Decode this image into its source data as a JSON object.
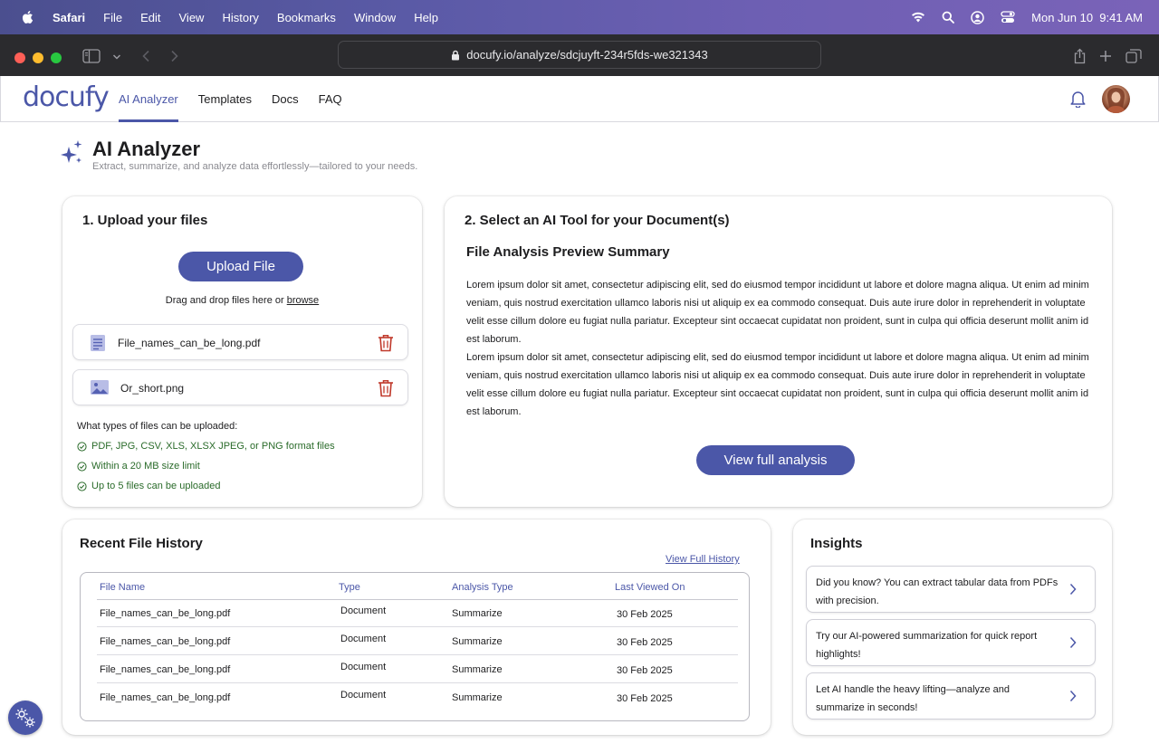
{
  "menubar": {
    "app": "Safari",
    "items": [
      "File",
      "Edit",
      "View",
      "History",
      "Bookmarks",
      "Window",
      "Help"
    ],
    "datetime": "Mon Jun 10  9:41 AM"
  },
  "browser": {
    "url": "docufy.io/analyze/sdcjuyft-234r5fds-we321343"
  },
  "header": {
    "logo": "docufy",
    "tabs": [
      {
        "label": "AI Analyzer",
        "active": true
      },
      {
        "label": "Templates"
      },
      {
        "label": "Docs"
      },
      {
        "label": "FAQ"
      }
    ]
  },
  "page": {
    "title": "AI Analyzer",
    "subtitle": "Extract, summarize, and analyze data effortlessly—tailored to your needs."
  },
  "upload": {
    "heading": "1. Upload your files",
    "button": "Upload File",
    "drag_text": "Drag and drop files here or ",
    "browse": "browse",
    "files": [
      {
        "name": "File_names_can_be_long.pdf",
        "icon": "document-icon"
      },
      {
        "name": "Or_short.png",
        "icon": "image-icon"
      }
    ],
    "types_heading": "What types of files can be uploaded:",
    "rules": [
      "PDF, JPG, CSV, XLS, XLSX JPEG, or PNG format files",
      "Within a 20 MB size limit",
      "Up to 5 files can be uploaded"
    ],
    "accent": "#2a6b2a"
  },
  "tool": {
    "heading": "2. Select an AI Tool for your Document(s)",
    "preview_title": "File Analysis Preview Summary",
    "paragraphs": [
      "Lorem ipsum dolor sit amet, consectetur adipiscing elit, sed do eiusmod tempor incididunt ut labore et dolore magna aliqua. Ut enim ad minim veniam, quis nostrud exercitation ullamco laboris nisi ut aliquip ex ea commodo consequat. Duis aute irure dolor in reprehenderit in voluptate velit esse cillum dolore eu fugiat nulla pariatur. Excepteur sint occaecat cupidatat non proident, sunt in culpa qui officia deserunt mollit anim id est laborum.",
      "Lorem ipsum dolor sit amet, consectetur adipiscing elit, sed do eiusmod tempor incididunt ut labore et dolore magna aliqua. Ut enim ad minim veniam, quis nostrud exercitation ullamco laboris nisi ut aliquip ex ea commodo consequat. Duis aute irure dolor in reprehenderit in voluptate velit esse cillum dolore eu fugiat nulla pariatur. Excepteur sint occaecat cupidatat non proident, sunt in culpa qui officia deserunt mollit anim id est laborum."
    ],
    "button": "View full analysis"
  },
  "history": {
    "heading": "Recent File History",
    "link": "View Full History",
    "columns": [
      "File Name",
      "Type",
      "Analysis Type",
      "Last Viewed On"
    ],
    "rows": [
      [
        "File_names_can_be_long.pdf",
        "Document",
        "Summarize",
        "30 Feb 2025"
      ],
      [
        "File_names_can_be_long.pdf",
        "Document",
        "Summarize",
        "30 Feb 2025"
      ],
      [
        "File_names_can_be_long.pdf",
        "Document",
        "Summarize",
        "30 Feb 2025"
      ],
      [
        "File_names_can_be_long.pdf",
        "Document",
        "Summarize",
        "30 Feb 2025"
      ]
    ]
  },
  "insights": {
    "heading": "Insights",
    "items": [
      "Did you know? You can extract tabular data from PDFs with precision.",
      "Try our AI-powered summarization for quick report highlights!",
      "Let AI handle the heavy lifting—analyze and summarize in seconds!"
    ]
  },
  "colors": {
    "brand": "#4b57a8",
    "danger": "#c0392b",
    "success": "#2a6b2a"
  }
}
